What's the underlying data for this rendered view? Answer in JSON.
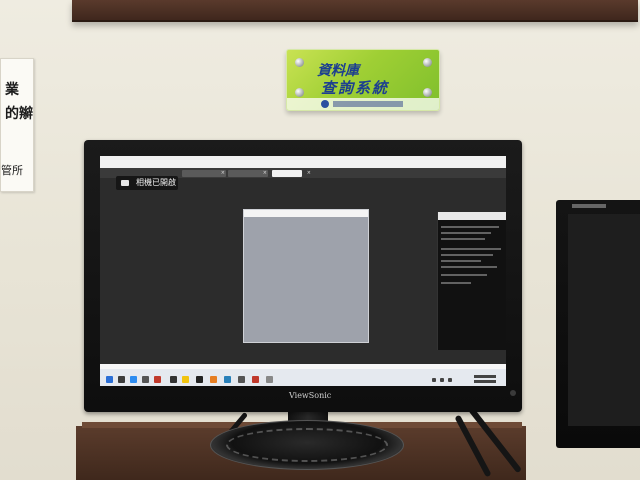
{
  "scene": {
    "wall_sign": {
      "line1": "資料庫",
      "line2": "查詢系統"
    },
    "wall_paper": {
      "line1": "業",
      "line2": "的辮",
      "line3": "管所"
    },
    "monitor": {
      "brand": "ViewSonic",
      "screen": {
        "camera_notification": "相機已開啟",
        "windows": [
          {
            "name": "image-viewer"
          },
          {
            "name": "console"
          }
        ]
      }
    }
  },
  "colors": {
    "wall": "#e9e5d8",
    "sign_green": "#9fcf34",
    "sign_text": "#1d3f8f",
    "desk": "#4b3022",
    "screen_bg": "#2c2c2c"
  }
}
